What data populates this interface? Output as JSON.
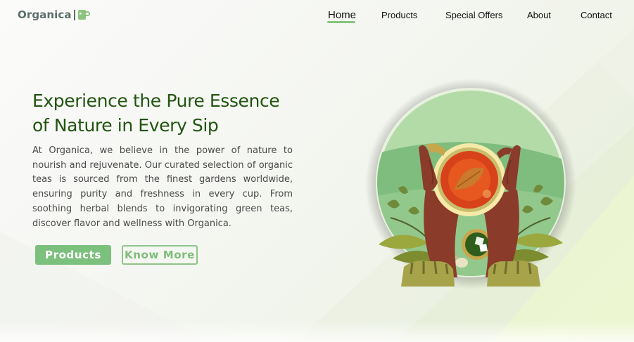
{
  "brand": {
    "name": "Organica",
    "logo_icon": "tea-cup-icon",
    "color": "#5b6f6b"
  },
  "nav": {
    "items": [
      {
        "label": "Home",
        "active": true
      },
      {
        "label": "Products",
        "active": false
      },
      {
        "label": "Special Offers",
        "active": false
      },
      {
        "label": "About",
        "active": false
      },
      {
        "label": "Contact",
        "active": false
      }
    ],
    "active_indicator_color": "#86c57b"
  },
  "hero": {
    "title": "Experience the Pure Essence of Nature in Every Sip",
    "description": "At Organica, we believe in the power of nature to nourish and rejuvenate. Our curated selection of organic teas is sourced from the finest gardens worldwide, ensuring purity and freshness in every cup. From soothing herbal blends to invigorating green teas, discover flavor and wellness with Organica.",
    "primary_button": "Products",
    "secondary_button": "Know More",
    "illustration": "hands-holding-tea-cup-illustration"
  },
  "colors": {
    "title": "#225411",
    "text": "#4a4a4a",
    "accent": "#7cc07d"
  }
}
